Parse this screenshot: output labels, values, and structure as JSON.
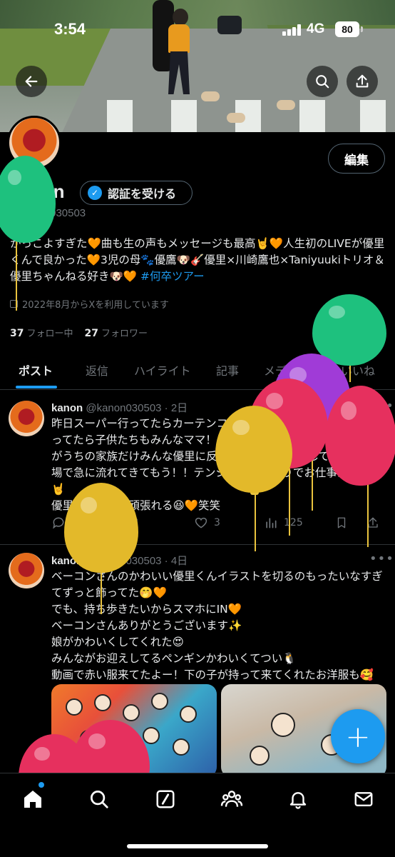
{
  "status_bar": {
    "time": "3:54",
    "network": "4G",
    "battery": "80"
  },
  "profile": {
    "edit_label": "編集",
    "display_name": "kanon",
    "verify_label": "認証を受ける",
    "handle": "@kanon030503",
    "bio_text": "かっこよすぎた🧡曲も生の声もメッセージも最高🤘🧡人生初のLIVEが優里くんで良かった🧡3児の母🐾優鷹🐶🎸優里×川崎鷹也×Taniyuukiトリオ＆優里ちゃんねる好き🐶🧡",
    "bio_tag": "#何卒ツアー",
    "joined": "2022年8月からXを利用しています",
    "following_count": "37",
    "following_label": "フォロー中",
    "followers_count": "27",
    "followers_label": "フォロワー"
  },
  "tabs": [
    {
      "label": "ポスト"
    },
    {
      "label": "返信"
    },
    {
      "label": "ハイライト"
    },
    {
      "label": "記事"
    },
    {
      "label": "メディア"
    },
    {
      "label": "いいね"
    }
  ],
  "tweets": [
    {
      "name": "kanon",
      "meta": "@kanon030503 · 2日",
      "more": "•••",
      "text": "昨日スーパー行ってたらカーテンコールが流れてきて😊！！ってなってたら子供たちもみんなママ！！カーテンコール！って🤣上の子がうちの家族だけみんな優里に反応した件🧡って話しててその夜職場で急に流れてきてもう！！テンション爆上がりでお仕事出来た🤭🤘\n優里聴きながら頑張れる😆🧡笑笑",
      "replies": "1",
      "likes": "3",
      "views": "125"
    },
    {
      "name": "kanon",
      "meta": "@kanon030503 · 4日",
      "more": "•••",
      "text": "ベーコンさんのかわいい優里くんイラストを切るのもったいなすぎてずっと飾ってた🤭🧡\nでも、持ち歩きたいからスマホにIN🧡\nベーコンさんありがとうございます✨\n娘がかわいくしてくれた😍\nみんながお迎えしてるペンギンかわいくてつい🐧\n動画で赤い服来てたよー！下の子が持って来てくれたお洋服も🥰"
    }
  ],
  "fab_label": "+",
  "icons": {
    "back": "back-arrow-icon",
    "search": "search-icon",
    "share": "share-icon",
    "nav": [
      "home-icon",
      "search-icon",
      "grok-icon",
      "communities-icon",
      "notifications-icon",
      "messages-icon"
    ]
  },
  "colors": {
    "accent": "#1d9bf0",
    "background": "#000000",
    "muted": "#71767b"
  }
}
